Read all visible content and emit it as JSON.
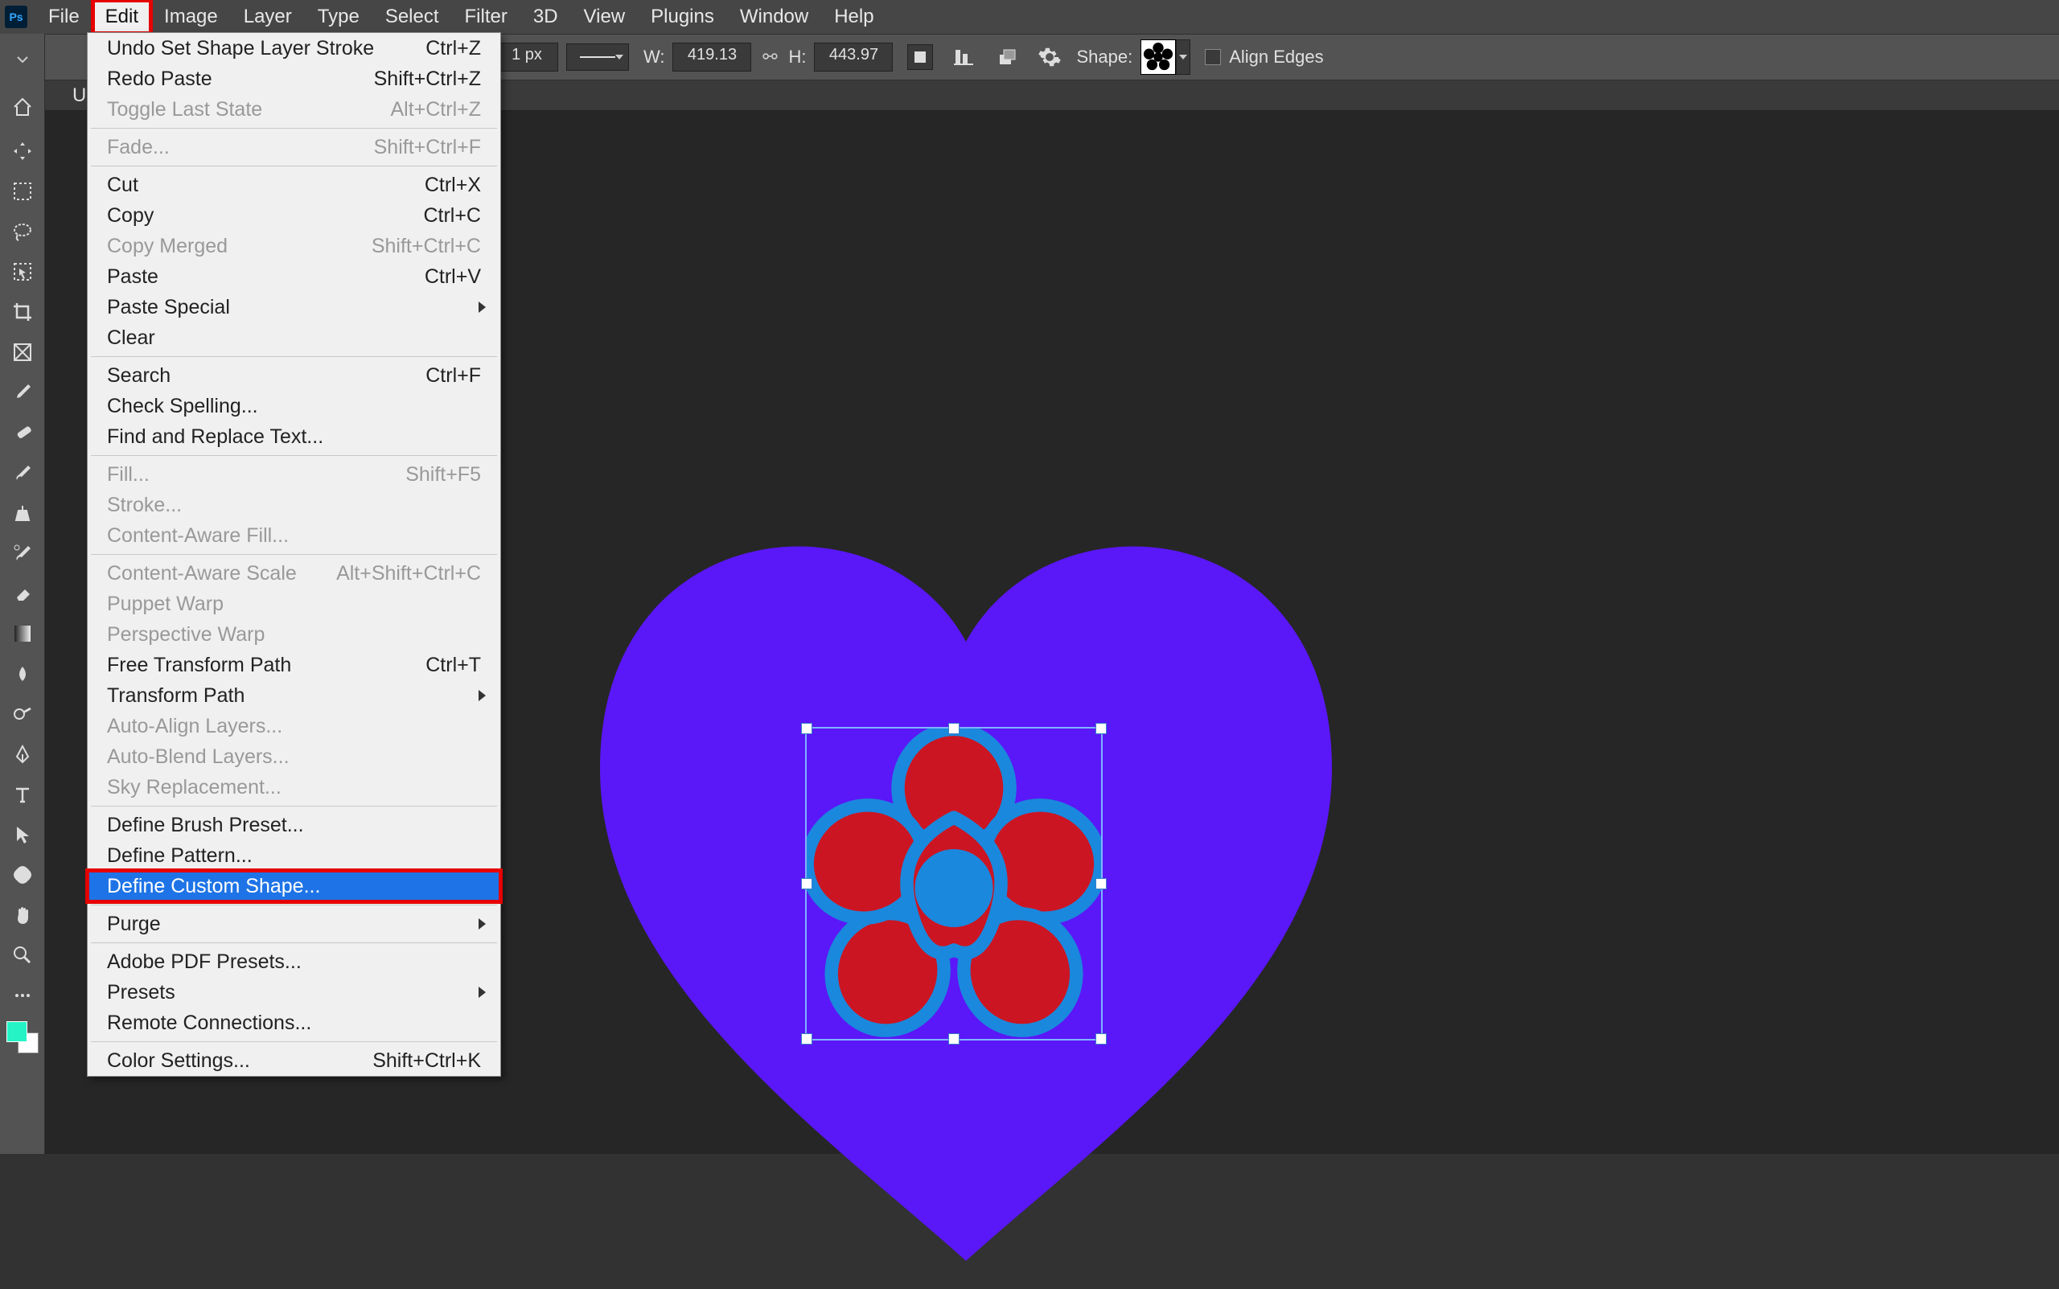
{
  "menubar": {
    "ps": "Ps",
    "items": [
      "File",
      "Edit",
      "Image",
      "Layer",
      "Type",
      "Select",
      "Filter",
      "3D",
      "View",
      "Plugins",
      "Window",
      "Help"
    ],
    "active_index": 1
  },
  "optionsbar": {
    "stroke_width": "1 px",
    "w_label": "W:",
    "w_value": "419.13",
    "h_label": "H:",
    "h_value": "443.97",
    "shape_label": "Shape:",
    "align_edges": "Align Edges"
  },
  "tab": {
    "label": "U"
  },
  "edit_menu": {
    "groups": [
      [
        {
          "label": "Undo Set Shape Layer Stroke",
          "shortcut": "Ctrl+Z",
          "enabled": true
        },
        {
          "label": "Redo Paste",
          "shortcut": "Shift+Ctrl+Z",
          "enabled": true
        },
        {
          "label": "Toggle Last State",
          "shortcut": "Alt+Ctrl+Z",
          "enabled": false
        }
      ],
      [
        {
          "label": "Fade...",
          "shortcut": "Shift+Ctrl+F",
          "enabled": false
        }
      ],
      [
        {
          "label": "Cut",
          "shortcut": "Ctrl+X",
          "enabled": true
        },
        {
          "label": "Copy",
          "shortcut": "Ctrl+C",
          "enabled": true
        },
        {
          "label": "Copy Merged",
          "shortcut": "Shift+Ctrl+C",
          "enabled": false
        },
        {
          "label": "Paste",
          "shortcut": "Ctrl+V",
          "enabled": true
        },
        {
          "label": "Paste Special",
          "shortcut": "",
          "enabled": true,
          "submenu": true
        },
        {
          "label": "Clear",
          "shortcut": "",
          "enabled": true
        }
      ],
      [
        {
          "label": "Search",
          "shortcut": "Ctrl+F",
          "enabled": true
        },
        {
          "label": "Check Spelling...",
          "shortcut": "",
          "enabled": true
        },
        {
          "label": "Find and Replace Text...",
          "shortcut": "",
          "enabled": true
        }
      ],
      [
        {
          "label": "Fill...",
          "shortcut": "Shift+F5",
          "enabled": false
        },
        {
          "label": "Stroke...",
          "shortcut": "",
          "enabled": false
        },
        {
          "label": "Content-Aware Fill...",
          "shortcut": "",
          "enabled": false
        }
      ],
      [
        {
          "label": "Content-Aware Scale",
          "shortcut": "Alt+Shift+Ctrl+C",
          "enabled": false
        },
        {
          "label": "Puppet Warp",
          "shortcut": "",
          "enabled": false
        },
        {
          "label": "Perspective Warp",
          "shortcut": "",
          "enabled": false
        },
        {
          "label": "Free Transform Path",
          "shortcut": "Ctrl+T",
          "enabled": true
        },
        {
          "label": "Transform Path",
          "shortcut": "",
          "enabled": true,
          "submenu": true
        },
        {
          "label": "Auto-Align Layers...",
          "shortcut": "",
          "enabled": false
        },
        {
          "label": "Auto-Blend Layers...",
          "shortcut": "",
          "enabled": false
        },
        {
          "label": "Sky Replacement...",
          "shortcut": "",
          "enabled": false
        }
      ],
      [
        {
          "label": "Define Brush Preset...",
          "shortcut": "",
          "enabled": true
        },
        {
          "label": "Define Pattern...",
          "shortcut": "",
          "enabled": true
        },
        {
          "label": "Define Custom Shape...",
          "shortcut": "",
          "enabled": true,
          "highlight": true
        }
      ],
      [
        {
          "label": "Purge",
          "shortcut": "",
          "enabled": true,
          "submenu": true
        }
      ],
      [
        {
          "label": "Adobe PDF Presets...",
          "shortcut": "",
          "enabled": true
        },
        {
          "label": "Presets",
          "shortcut": "",
          "enabled": true,
          "submenu": true
        },
        {
          "label": "Remote Connections...",
          "shortcut": "",
          "enabled": true
        }
      ],
      [
        {
          "label": "Color Settings...",
          "shortcut": "Shift+Ctrl+K",
          "enabled": true
        }
      ]
    ]
  },
  "tools": [
    "move",
    "marquee",
    "lasso",
    "object-select",
    "crop",
    "frame",
    "eyedropper",
    "healing",
    "brush",
    "clone",
    "history-brush",
    "eraser",
    "gradient",
    "blur",
    "dodge",
    "pen",
    "type",
    "path-select",
    "custom-shape",
    "hand",
    "zoom"
  ],
  "colors": {
    "heart": "#5a17f7",
    "flower_fill": "#cc1522",
    "flower_stroke": "#1a88dd"
  }
}
